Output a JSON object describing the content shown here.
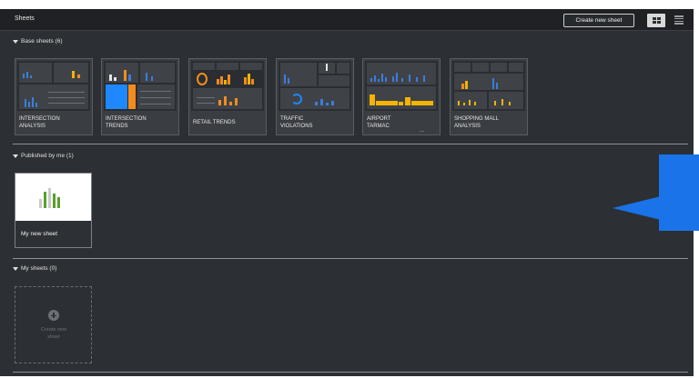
{
  "header": {
    "title": "Sheets",
    "create_button": "Create new sheet",
    "views": [
      "grid-view-icon",
      "list-view-icon"
    ]
  },
  "sections": {
    "base": {
      "title": "Base sheets (6)"
    },
    "published": {
      "title": "Published by me (1)"
    },
    "mine": {
      "title": "My sheets (0)"
    }
  },
  "base_sheets": [
    {
      "line1": "INTERSECTION",
      "line2": "ANALYSIS"
    },
    {
      "line1": "INTERSECTION",
      "line2": "TRENDS"
    },
    {
      "line1": "RETAIL TRENDS",
      "line2": ""
    },
    {
      "line1": "TRAFFIC",
      "line2": "VIOLATIONS"
    },
    {
      "line1": "AIRPORT",
      "line2": "TARMAC",
      "more": "..."
    },
    {
      "line1": "SHOPPING MALL",
      "line2": "ANALYSIS"
    }
  ],
  "published_sheets": [
    {
      "label": "My new sheet"
    }
  ],
  "empty_sheet": {
    "line1": "Create new",
    "line2": "sheet"
  },
  "colors": {
    "accent_blue": "#1a73e8",
    "orange": "#f28c1e",
    "yellow": "#f5b400",
    "green": "#5aa02c",
    "background": "#2c2f33"
  }
}
